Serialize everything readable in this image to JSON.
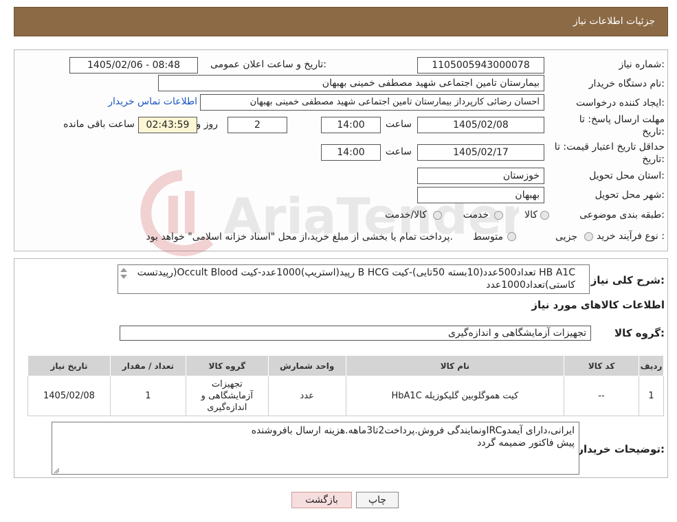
{
  "header": {
    "title": "جزئیات اطلاعات نیاز"
  },
  "details": {
    "need_number_label": "شماره نیاز:",
    "need_number": "1105005943000078",
    "announce_label": "تاریخ و ساعت اعلان عمومی:",
    "announce_value": "1405/02/06 - 08:48",
    "buyer_org_label": "نام دستگاه خریدار:",
    "buyer_org": "بیمارستان تامین اجتماعی شهید مصطفی خمینی بهبهان",
    "requester_label": "ایجاد کننده درخواست:",
    "requester": "احسان رضائی کارپرداز بیمارستان تامین اجتماعی شهید مصطفی خمینی بهبهان",
    "contact_link": "اطلاعات تماس خریدار",
    "reply_deadline_label_1": "مهلت ارسال پاسخ: تا",
    "reply_deadline_label_2": "تاریخ:",
    "reply_date": "1405/02/08",
    "time_label": "ساعت",
    "reply_time": "14:00",
    "days_value": "2",
    "days_label": "روز و",
    "remaining_time": "02:43:59",
    "remaining_label": "ساعت باقی مانده",
    "price_validity_label_1": "حداقل تاریخ اعتبار قیمت: تا",
    "price_validity_label_2": "تاریخ:",
    "price_date": "1405/02/17",
    "price_time_label": "ساعت",
    "price_time": "14:00",
    "province_label": "استان محل تحویل:",
    "province": "خوزستان",
    "city_label": "شهر محل تحویل:",
    "city": "بهبهان",
    "category_label": "طبقه بندی موضوعی:",
    "category_options": [
      "کالا",
      "خدمت",
      "کالا/خدمت"
    ],
    "process_label": "نوع فرآیند خرید :",
    "process_options": [
      "جزیی",
      "متوسط"
    ],
    "process_note": "پرداخت تمام یا بخشی از مبلغ خرید،از محل \"اسناد خزانه اسلامی\" خواهد بود."
  },
  "description": {
    "label": "شرح کلی نیاز:",
    "text": "HB A1C تعداد500عدد(10بسته 50تایی)-کیت B HCG رپید(استریپ)1000عدد-کیت Occult Blood(رپیدتست کاستی)تعداد1000عدد"
  },
  "goods": {
    "section_title": "اطلاعات کالاهای مورد نیاز",
    "group_label": "گروه کالا:",
    "group_value": "تجهیزات آزمایشگاهی و اندازه‌گیری"
  },
  "table": {
    "headers": [
      "ردیف",
      "کد کالا",
      "نام کالا",
      "واحد شمارش",
      "گروه کالا",
      "تعداد / مقدار",
      "تاریخ نیاز"
    ],
    "rows": [
      [
        "1",
        "--",
        "کیت هموگلوبین گلیکوزیله HbA1C",
        "عدد",
        "تجهیزات آزمایشگاهی و اندازه‌گیری",
        "1",
        "1405/02/08"
      ]
    ]
  },
  "buyer_notes": {
    "label": "توضیحات خریدار:",
    "line1": "ایرانی،دارای آیمدوIRCونمایندگی فروش.پرداخت2تا3ماهه.هزینه ارسال بافروشنده",
    "line2": "پیش فاکتور ضمیمه گردد"
  },
  "buttons": {
    "print": "چاپ",
    "back": "بازگشت"
  },
  "watermark": {
    "text": "AriaTender.neT"
  },
  "colors": {
    "header_bg": "#8b6a45",
    "link": "#1a55c4",
    "back_button_bg": "#f7dede",
    "remaining_bg": "#fbf6d3"
  }
}
